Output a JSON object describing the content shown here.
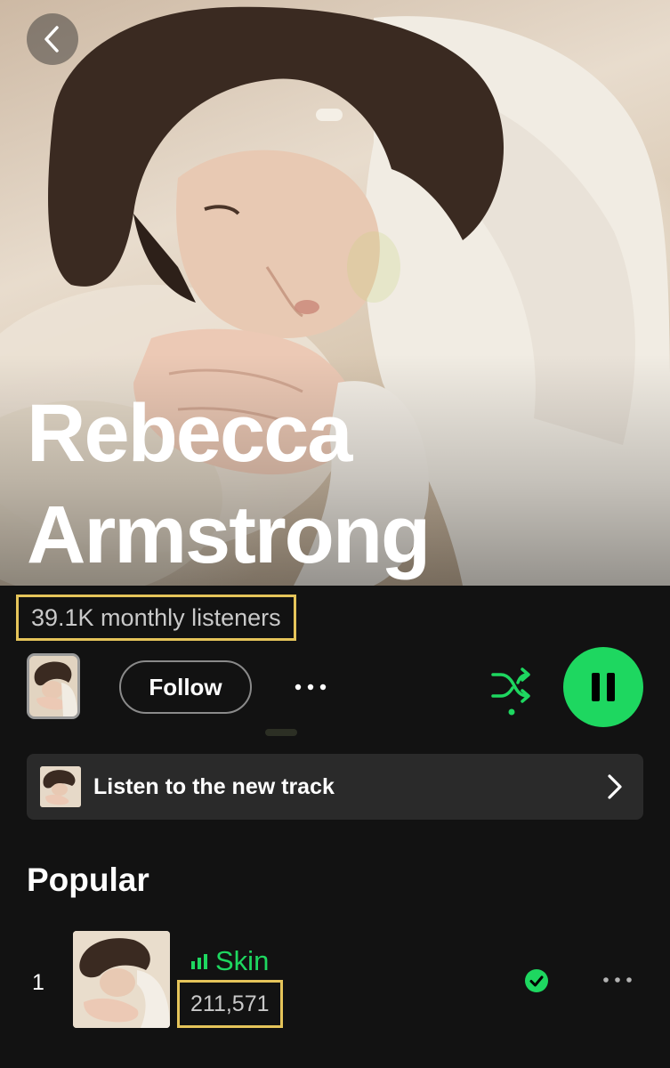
{
  "artist": {
    "name_line1": "Rebecca",
    "name_line2": "Armstrong",
    "monthly_listeners": "39.1K monthly listeners"
  },
  "actions": {
    "follow_label": "Follow"
  },
  "banner": {
    "label": "Listen to the new track"
  },
  "popular": {
    "title": "Popular",
    "tracks": [
      {
        "rank": "1",
        "title": "Skin",
        "plays": "211,571",
        "playing": true,
        "downloaded": true
      }
    ]
  },
  "colors": {
    "accent_green": "#1ed760",
    "highlight_box": "#e5c45a",
    "background": "#121212",
    "banner_bg": "#2a2a2a"
  },
  "icons": {
    "back": "chevron-left-icon",
    "more": "more-horizontal-icon",
    "shuffle": "shuffle-icon",
    "play_pause": "pause-icon",
    "banner_chevron": "chevron-right-icon",
    "now_playing": "equalizer-bars-icon",
    "downloaded": "check-circle-icon"
  }
}
